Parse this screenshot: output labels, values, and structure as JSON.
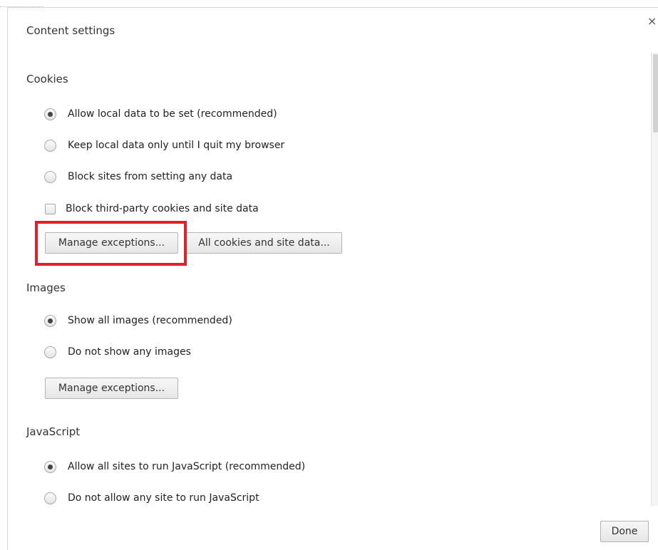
{
  "dialog": {
    "title": "Content settings",
    "close_glyph": "×",
    "done_label": "Done"
  },
  "cookies": {
    "heading": "Cookies",
    "options": [
      {
        "label": "Allow local data to be set (recommended)",
        "checked": true
      },
      {
        "label": "Keep local data only until I quit my browser",
        "checked": false
      },
      {
        "label": "Block sites from setting any data",
        "checked": false
      }
    ],
    "checkbox_label": "Block third-party cookies and site data",
    "checkbox_checked": false,
    "manage_exceptions_label": "Manage exceptions...",
    "all_cookies_label": "All cookies and site data..."
  },
  "images": {
    "heading": "Images",
    "options": [
      {
        "label": "Show all images (recommended)",
        "checked": true
      },
      {
        "label": "Do not show any images",
        "checked": false
      }
    ],
    "manage_exceptions_label": "Manage exceptions..."
  },
  "javascript": {
    "heading": "JavaScript",
    "options": [
      {
        "label": "Allow all sites to run JavaScript (recommended)",
        "checked": true
      },
      {
        "label": "Do not allow any site to run JavaScript",
        "checked": false
      }
    ]
  },
  "colors": {
    "highlight": "#e0202a",
    "button_border": "#b4b4b4"
  },
  "icons": {
    "close": "close-icon"
  }
}
